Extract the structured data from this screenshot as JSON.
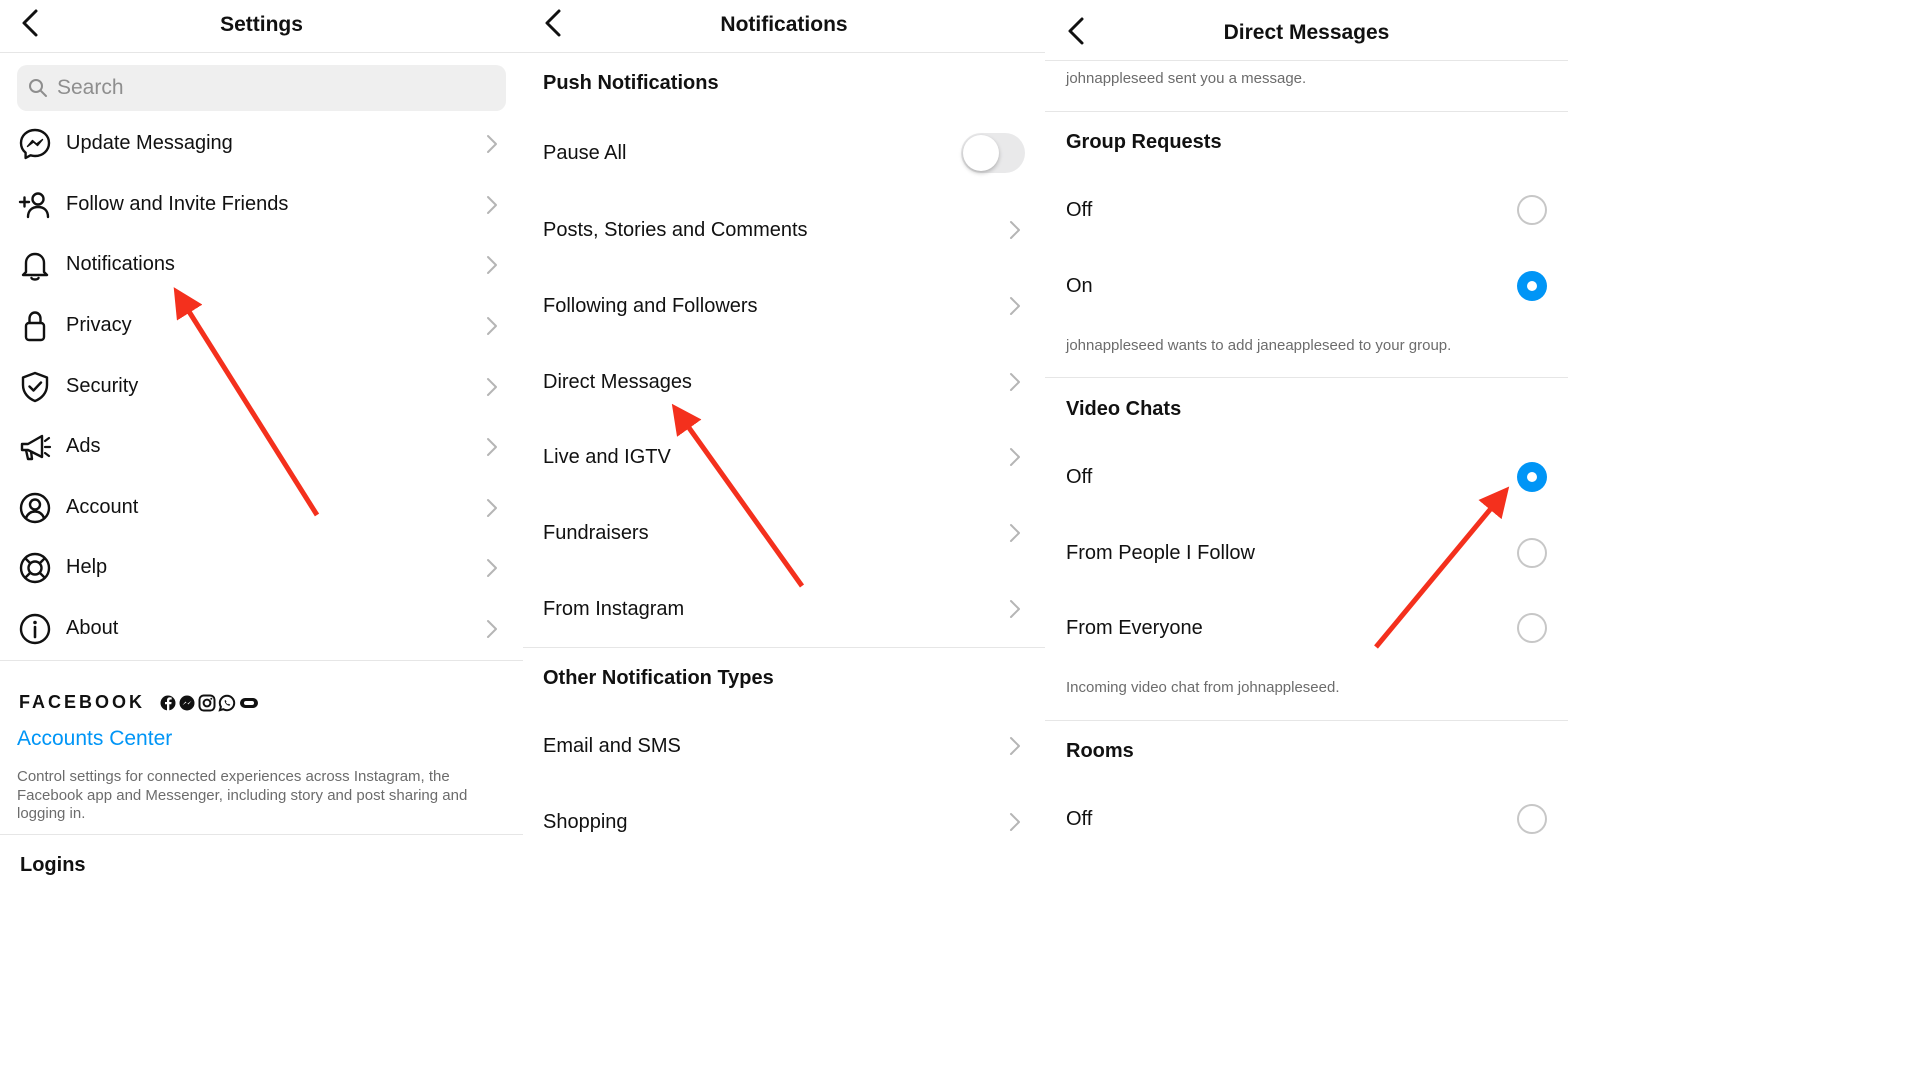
{
  "settings": {
    "title": "Settings",
    "search": {
      "placeholder": "Search",
      "value": ""
    },
    "items": [
      {
        "label": "Update Messaging",
        "icon": "messenger-icon"
      },
      {
        "label": "Follow and Invite Friends",
        "icon": "add-person-icon"
      },
      {
        "label": "Notifications",
        "icon": "bell-icon"
      },
      {
        "label": "Privacy",
        "icon": "lock-icon"
      },
      {
        "label": "Security",
        "icon": "shield-icon"
      },
      {
        "label": "Ads",
        "icon": "megaphone-icon"
      },
      {
        "label": "Account",
        "icon": "account-circle-icon"
      },
      {
        "label": "Help",
        "icon": "lifebuoy-icon"
      },
      {
        "label": "About",
        "icon": "info-icon"
      }
    ],
    "facebook": {
      "brand": "FACEBOOK",
      "accounts_center": "Accounts Center",
      "description": "Control settings for connected experiences across Instagram, the Facebook app and Messenger, including story and post sharing and logging in."
    },
    "logins": "Logins"
  },
  "notifications": {
    "title": "Notifications",
    "push_title": "Push Notifications",
    "pause_all": {
      "label": "Pause All",
      "enabled": false
    },
    "push_items": [
      {
        "label": "Posts, Stories and Comments"
      },
      {
        "label": "Following and Followers"
      },
      {
        "label": "Direct Messages"
      },
      {
        "label": "Live and IGTV"
      },
      {
        "label": "Fundraisers"
      },
      {
        "label": "From Instagram"
      }
    ],
    "other_title": "Other Notification Types",
    "other_items": [
      {
        "label": "Email and SMS"
      },
      {
        "label": "Shopping"
      }
    ]
  },
  "direct_messages": {
    "title": "Direct Messages",
    "top_hint": "johnappleseed sent you a message.",
    "group_requests": {
      "title": "Group Requests",
      "options": [
        {
          "label": "Off",
          "selected": false
        },
        {
          "label": "On",
          "selected": true
        }
      ],
      "hint": "johnappleseed wants to add janeappleseed to your group."
    },
    "video_chats": {
      "title": "Video Chats",
      "options": [
        {
          "label": "Off",
          "selected": true
        },
        {
          "label": "From People I Follow",
          "selected": false
        },
        {
          "label": "From Everyone",
          "selected": false
        }
      ],
      "hint": "Incoming video chat from johnappleseed."
    },
    "rooms": {
      "title": "Rooms",
      "options": [
        {
          "label": "Off",
          "selected": false
        }
      ]
    }
  },
  "colors": {
    "accent_blue": "#0095f6",
    "annotation_arrow": "#f4301d",
    "secondary_text": "#6c6c6c"
  }
}
